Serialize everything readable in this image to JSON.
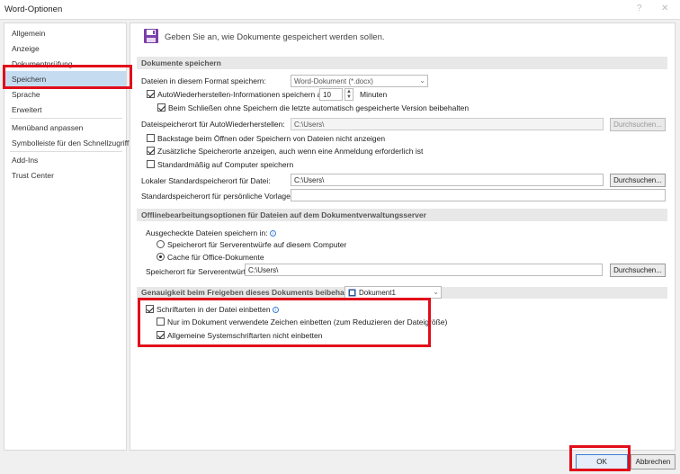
{
  "window": {
    "title": "Word-Optionen",
    "controls": [
      "?",
      "✕"
    ]
  },
  "sidebar": {
    "items": [
      {
        "label": "Allgemein"
      },
      {
        "label": "Anzeige"
      },
      {
        "label": "Dokumentprüfung"
      },
      {
        "label": "Speichern",
        "selected": true
      },
      {
        "label": "Sprache"
      },
      {
        "label": "Erweitert"
      },
      {
        "label": "Menüband anpassen"
      },
      {
        "label": "Symbolleiste für den Schnellzugriff"
      },
      {
        "label": "Add-Ins"
      },
      {
        "label": "Trust Center"
      }
    ]
  },
  "header": {
    "icon": "floppy-disk-icon",
    "text": "Geben Sie an, wie Dokumente gespeichert werden sollen."
  },
  "save_section": {
    "title": "Dokumente speichern",
    "format_label": "Dateien in diesem Format speichern:",
    "format_value": "Word-Dokument (*.docx)",
    "autorecover_label": "AutoWiederherstellen-Informationen speichern alle",
    "autorecover_checked": true,
    "autorecover_minutes": "10",
    "minutes_label": "Minuten",
    "keep_last_label": "Beim Schließen ohne Speichern die letzte automatisch gespeicherte Version beibehalten",
    "keep_last_checked": true,
    "autorecover_location_label": "Dateispeicherort für AutoWiederherstellen:",
    "autorecover_location_value": "C:\\Users\\",
    "browse_label": "Durchsuchen...",
    "backstage_label": "Backstage beim Öffnen oder Speichern von Dateien nicht anzeigen",
    "backstage_checked": false,
    "extra_locations_label": "Zusätzliche Speicherorte anzeigen, auch wenn eine Anmeldung erforderlich ist",
    "extra_locations_checked": true,
    "default_computer_label": "Standardmäßig auf Computer speichern",
    "default_computer_checked": false,
    "local_default_label": "Lokaler Standardspeicherort für Datei:",
    "local_default_value": "C:\\Users\\",
    "templates_label": "Standardspeicherort für persönliche Vorlagen:",
    "templates_value": ""
  },
  "offline_section": {
    "title": "Offlinebearbeitungsoptionen für Dateien auf dem Dokumentverwaltungsserver",
    "checked_out_label": "Ausgecheckte Dateien speichern in:",
    "radio_server_label": "Speicherort für Serverentwürfe auf diesem Computer",
    "radio_server_checked": false,
    "radio_cache_label": "Cache für Office-Dokumente",
    "radio_cache_checked": true,
    "drafts_location_label": "Speicherort für Serverentwürfe:",
    "drafts_location_value": "C:\\Users\\",
    "browse_label": "Durchsuchen..."
  },
  "fidelity_section": {
    "title": "Genauigkeit beim Freigeben dieses Dokuments beibehalten:",
    "document_value": "Dokument1",
    "embed_fonts_label": "Schriftarten in der Datei einbetten",
    "embed_fonts_checked": true,
    "only_used_chars_label": "Nur im Dokument verwendete Zeichen einbetten (zum Reduzieren der Dateigröße)",
    "only_used_chars_checked": false,
    "no_system_fonts_label": "Allgemeine Systemschriftarten nicht einbetten",
    "no_system_fonts_checked": true
  },
  "footer": {
    "ok_label": "OK",
    "cancel_label": "Abbrechen"
  },
  "colors": {
    "highlight_red": "#e10d1a",
    "selected_nav": "#c5dbf0",
    "section_header": "#e8e8e8",
    "accent_purple": "#7b3fa8"
  }
}
